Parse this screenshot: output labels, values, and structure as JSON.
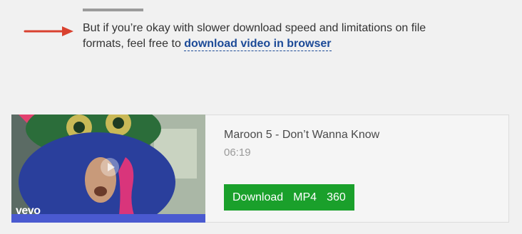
{
  "intro": {
    "text": "But if you’re okay with slower download speed and limitations on file formats, feel free to ",
    "link_text": "download video in browser"
  },
  "video": {
    "title": "Maroon 5 - Don’t Wanna Know",
    "duration": "06:19",
    "watermark": "vevo"
  },
  "download": {
    "label": "Download",
    "format": "MP4",
    "quality": "360"
  },
  "colors": {
    "link": "#1c4a97",
    "button": "#1aa02b",
    "arrow": "#d9412f",
    "rule": "#9b9b9b"
  },
  "icons": [
    "arrow-pointer-icon",
    "play-icon"
  ]
}
